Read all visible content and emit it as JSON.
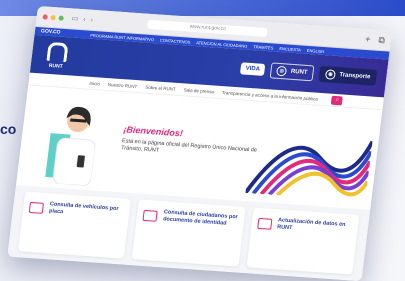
{
  "backdrop": {
    "side_text": "co"
  },
  "browser": {
    "url": "www.runt.gov.co",
    "nav_icons": [
      "sidebar-icon",
      "back-icon",
      "forward-icon"
    ],
    "right_icons": [
      "plus-icon",
      "copy-icon"
    ]
  },
  "gov_bar": {
    "brand": "GOV.CO",
    "links": [
      "PROGRAMA RUNT INFORMATIVO",
      "CONTACTENOS",
      "ATENCION AL CIUDADANO",
      "TRAMITES",
      "ENCUESTA",
      "ENGLISH"
    ]
  },
  "header": {
    "logo_text": "RUNT",
    "vida_badge": "VIDA",
    "pill_1": "RUNT",
    "pill_2": "Transporte"
  },
  "nav": {
    "items": [
      "Inicio",
      "Nuestro RUNT",
      "Sobre el RUNT",
      "Sala de prensa",
      "Transparencia y acceso a la información pública"
    ],
    "search_icon": "search-icon"
  },
  "hero": {
    "title": "¡Bienvenidos!",
    "subtitle": "Está en la página oficial del Registro Único Nacional de Tránsito, RUNT"
  },
  "cards": [
    {
      "label": "Consulta de vehículos por placa",
      "icon": "car-card-icon"
    },
    {
      "label": "Consulta de ciudadanos por documento de identidad",
      "icon": "id-card-icon"
    },
    {
      "label": "Actualización de datos en RUNT",
      "icon": "update-icon"
    }
  ],
  "colors": {
    "primary": "#2a3fa8",
    "accent": "#e4287a",
    "gov_blue": "#2a4bd0"
  }
}
